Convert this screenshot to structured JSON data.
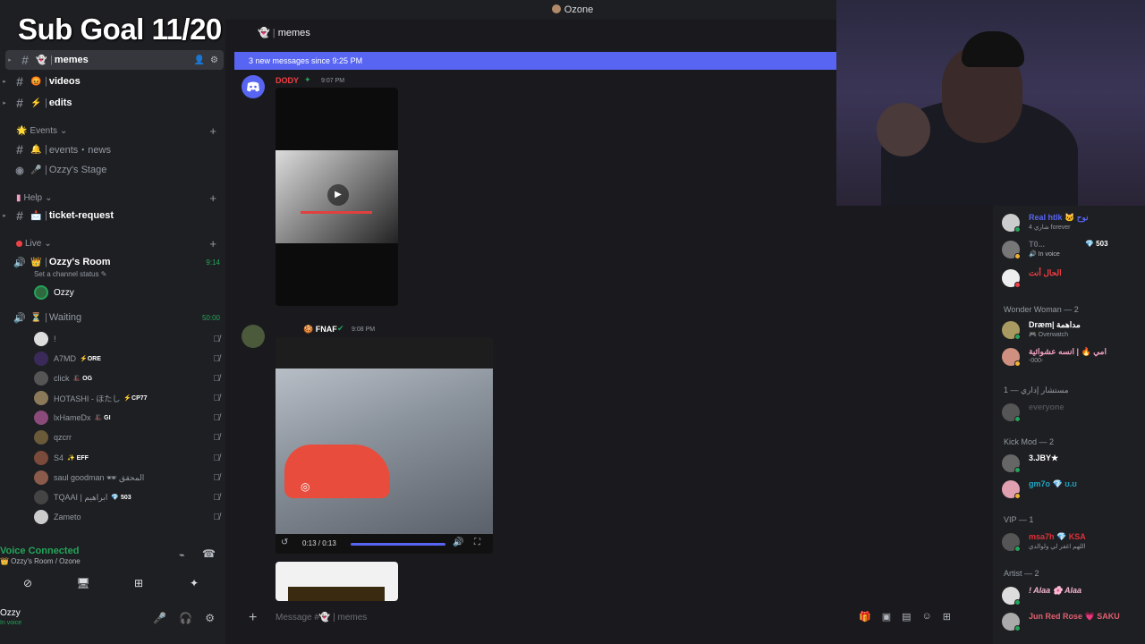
{
  "app_title": "Ozone",
  "overlay": {
    "title": "Sub Goal 11/20"
  },
  "chat": {
    "channel_header": "memes",
    "new_messages_banner": "3 new messages since 9:25 PM",
    "messages": [
      {
        "author": "DODY",
        "time": "9:07 PM"
      },
      {
        "author": "FNAF",
        "time": "9:08 PM"
      }
    ],
    "video_player": {
      "time": "0:13 / 0:13",
      "progress": 1.0
    },
    "composer_placeholder": "Message #👻 | memes"
  },
  "sidebar": {
    "channels_top": [
      {
        "name": "memes",
        "emoji": "👻",
        "active": true
      },
      {
        "name": "videos",
        "emoji": "😡",
        "active": false
      },
      {
        "name": "edits",
        "emoji": "⚡",
        "active": false
      }
    ],
    "categories": {
      "events": "Events",
      "help": "Help",
      "live": "Live"
    },
    "events_channels": [
      {
        "name": "events・news",
        "emoji": "🔔"
      },
      {
        "name": "Ozzy's Stage",
        "emoji": "🎤"
      }
    ],
    "help_channels": [
      {
        "name": "ticket-request",
        "emoji": "📩"
      }
    ],
    "live_channels": {
      "room": {
        "name": "Ozzy's Room",
        "emoji": "👑",
        "time": "9:14",
        "status": "Set a channel status"
      },
      "room_user": "Ozzy",
      "waiting": {
        "name": "Waiting",
        "emoji": "⏳",
        "time": "50:00"
      }
    },
    "waiting_users": [
      {
        "name": "!",
        "tag": ""
      },
      {
        "name": "A7MD",
        "tag": "⚡ORE"
      },
      {
        "name": "click",
        "tag": "🎩 OG"
      },
      {
        "name": "HOTASHI - ほたし",
        "tag": "⚡CP77"
      },
      {
        "name": "lxHameDx",
        "tag": "🎩 GI"
      },
      {
        "name": "qzcrr",
        "tag": ""
      },
      {
        "name": "S4",
        "tag": "✨ EFF"
      },
      {
        "name": "saul goodman 🕶 المحقق",
        "tag": ""
      },
      {
        "name": "TQAAI | ابراهيم",
        "tag": "💎 503"
      },
      {
        "name": "Zameto",
        "tag": ""
      }
    ],
    "voice_panel": {
      "status": "Voice Connected",
      "location": "👑 Ozzy's Room / Ozone"
    },
    "user_panel": {
      "name": "Ozzy",
      "status": "In voice"
    }
  },
  "members": {
    "top": [
      {
        "name": "Real htlk 🐱 نوح",
        "sub": "4 شاري forever",
        "color": "#5865f2"
      },
      {
        "name": "T0...",
        "sub": "🔊 In voice",
        "tag": "💎 503",
        "color": "#6b6f7a"
      },
      {
        "name": "الحال أنت",
        "sub": "",
        "color": "#f23f43"
      }
    ],
    "roles": [
      {
        "name": "Wonder Woman — 2",
        "members": [
          {
            "name": "Dræm| مداهمة",
            "sub": "🎮 Overwatch",
            "color": "#ffffff"
          },
          {
            "name": "امي 🔥 | انسه عشوائية",
            "sub": "-000-",
            "color": "#f0a0c0"
          }
        ]
      },
      {
        "name": "مستشار إداري — 1",
        "members": [
          {
            "name": "everyone",
            "sub": "",
            "color": "#4e5058"
          }
        ]
      },
      {
        "name": "Kick Mod — 2",
        "members": [
          {
            "name": "3.JBY★",
            "sub": "",
            "color": "#ffffff"
          },
          {
            "name": "gm7o 💎 ʊ.ʊ",
            "sub": "",
            "color": "#23a5c5"
          }
        ]
      },
      {
        "name": "VIP — 1",
        "members": [
          {
            "name": "msa7h 💎 KSA",
            "sub": "اللهم اغفر لي ولوالدي",
            "color": "#e0303a"
          }
        ]
      },
      {
        "name": "Artist — 2",
        "members": [
          {
            "name": "! Alaa 🌸 Alaa",
            "sub": "",
            "color": "#f5b6d0"
          },
          {
            "name": "Jun Red Rose 💗 SAKU",
            "sub": "",
            "color": "#e06070"
          }
        ]
      }
    ]
  },
  "colors": {
    "accent": "#5865f2",
    "online": "#23a55a",
    "background": "#1a1a1e",
    "sidebar": "#1e1f22"
  }
}
